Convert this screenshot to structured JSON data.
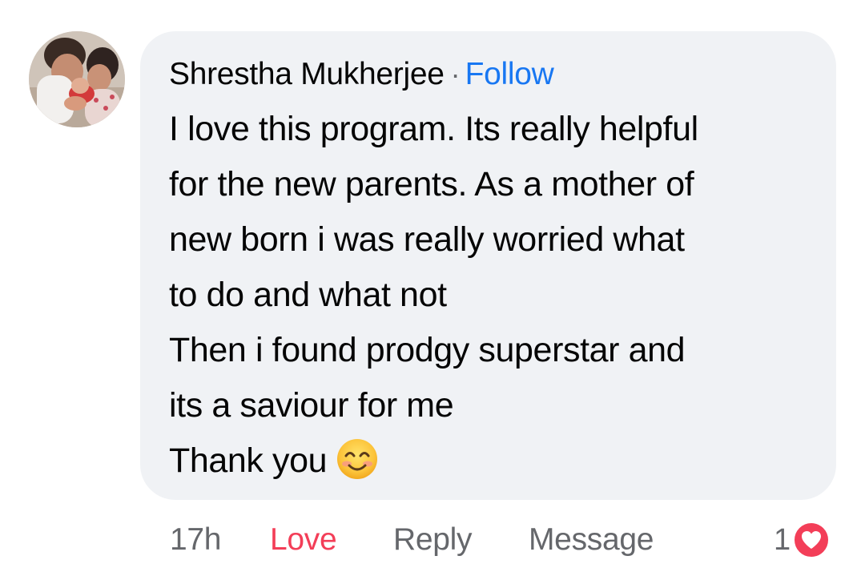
{
  "comment": {
    "author": "Shrestha Mukherjee",
    "separator": "·",
    "follow_label": "Follow",
    "body_lines": [
      "I love this program. Its really helpful",
      "for the new parents. As a mother of",
      "new born i was really worried what",
      "to do and what not",
      "Then i found prodgy superstar and",
      "its a saviour for me",
      "Thank you"
    ],
    "emoji": "smiling-face-with-smiling-eyes"
  },
  "actions": {
    "time": "17h",
    "love_label": "Love",
    "reply_label": "Reply",
    "message_label": "Message"
  },
  "reactions": {
    "count": "1",
    "type": "heart-icon"
  },
  "colors": {
    "bubble_bg": "#f0f2f5",
    "follow": "#1877f2",
    "love": "#f33e58",
    "muted": "#65676b",
    "text": "#050505"
  }
}
